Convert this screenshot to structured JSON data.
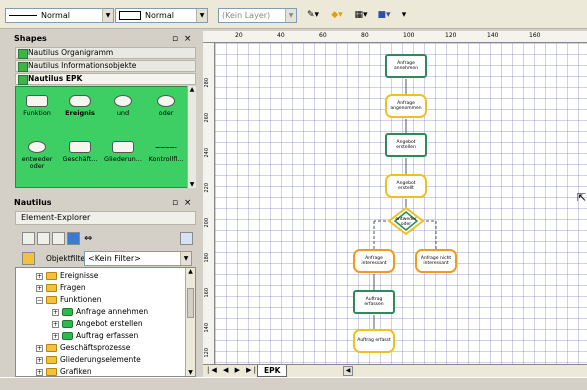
{
  "toolbar": {
    "line_style": "Normal",
    "fill_style": "Normal",
    "layer": "(Kein Layer)"
  },
  "shapes_panel": {
    "title": "Shapes",
    "stencils": [
      "Nautilus Organigramm",
      "Nautilus Informationsobjekte",
      "Nautilus EPK"
    ],
    "items": [
      {
        "label": "Funktion",
        "icon": "function-shape-icon"
      },
      {
        "label": "Ereignis",
        "icon": "event-shape-icon"
      },
      {
        "label": "und",
        "icon": "and-connector-icon"
      },
      {
        "label": "oder",
        "icon": "or-connector-icon"
      },
      {
        "label": "entweder oder",
        "icon": "xor-connector-icon"
      },
      {
        "label": "Geschäft...",
        "icon": "business-object-icon"
      },
      {
        "label": "Gliederun...",
        "icon": "structure-element-icon"
      },
      {
        "label": "Kontrollfl...",
        "icon": "control-flow-icon"
      }
    ]
  },
  "nautilus_panel": {
    "title": "Nautilus",
    "explorer_label": "Element-Explorer",
    "filter_label": "Objektfilter:",
    "filter_value": "<Kein Filter>",
    "tree": [
      {
        "label": "Ereignisse",
        "level": 0,
        "icon": "folder-icon"
      },
      {
        "label": "Fragen",
        "level": 0,
        "icon": "folder-icon"
      },
      {
        "label": "Funktionen",
        "level": 0,
        "icon": "folder-icon"
      },
      {
        "label": "Anfrage annehmen",
        "level": 1,
        "icon": "function-icon"
      },
      {
        "label": "Angebot erstellen",
        "level": 1,
        "icon": "function-icon"
      },
      {
        "label": "Auftrag erfassen",
        "level": 1,
        "icon": "function-icon"
      },
      {
        "label": "Geschäftsprozesse",
        "level": 0,
        "icon": "folder-icon"
      },
      {
        "label": "Gliederungselemente",
        "level": 0,
        "icon": "folder-icon"
      },
      {
        "label": "Grafiken",
        "level": 0,
        "icon": "folder-icon"
      }
    ]
  },
  "ruler": {
    "top_ticks": [
      "20",
      "40",
      "60",
      "80",
      "100",
      "120",
      "140",
      "160"
    ],
    "left_ticks": [
      "280",
      "260",
      "240",
      "220",
      "200",
      "180",
      "160",
      "140",
      "120"
    ]
  },
  "diagram": {
    "nodes": [
      {
        "label": "Anfrage annehmen",
        "kind": "function"
      },
      {
        "label": "Anfrage angenommen",
        "kind": "event"
      },
      {
        "label": "Angebot erstellen",
        "kind": "function"
      },
      {
        "label": "Angebot erstellt",
        "kind": "event"
      },
      {
        "label": "entweder oder",
        "kind": "connector"
      },
      {
        "label": "Anfrage interessant",
        "kind": "event"
      },
      {
        "label": "Anfrage nicht interessant",
        "kind": "event"
      },
      {
        "label": "Auftrag erfassen",
        "kind": "function"
      },
      {
        "label": "Auftrag erfasst",
        "kind": "event"
      }
    ]
  },
  "page_tab": "EPK",
  "colors": {
    "stencil_bg": "#3dcf63",
    "function_border": "#2e8b57",
    "event_border": "#f0c020"
  }
}
